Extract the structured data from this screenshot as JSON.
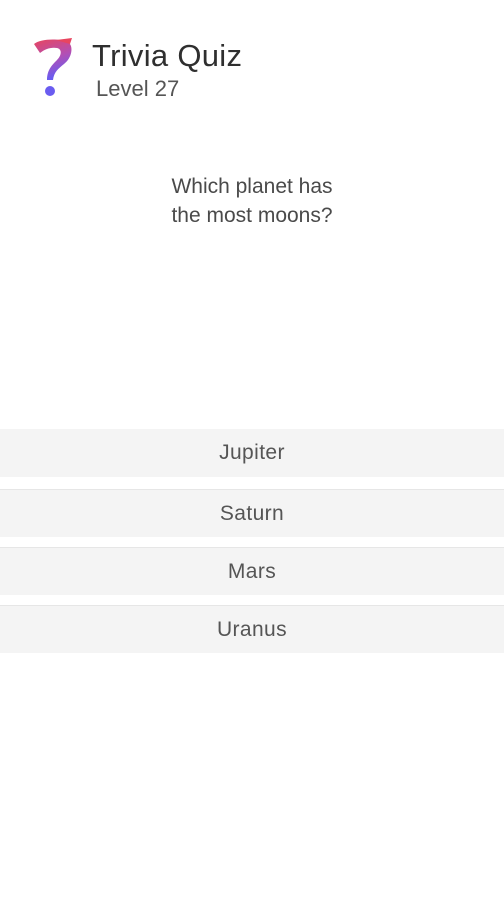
{
  "header": {
    "title": "Trivia Quiz",
    "subtitle": "Level 27",
    "logo_icon": "question-mark-icon",
    "logo_colors": {
      "top": "#e8455f",
      "bottom": "#6a5cf0"
    }
  },
  "question": {
    "line1": "Which planet has",
    "line2": "the most moons?"
  },
  "answers": [
    {
      "label": "Jupiter"
    },
    {
      "label": "Saturn"
    },
    {
      "label": "Mars"
    },
    {
      "label": "Uranus"
    }
  ]
}
